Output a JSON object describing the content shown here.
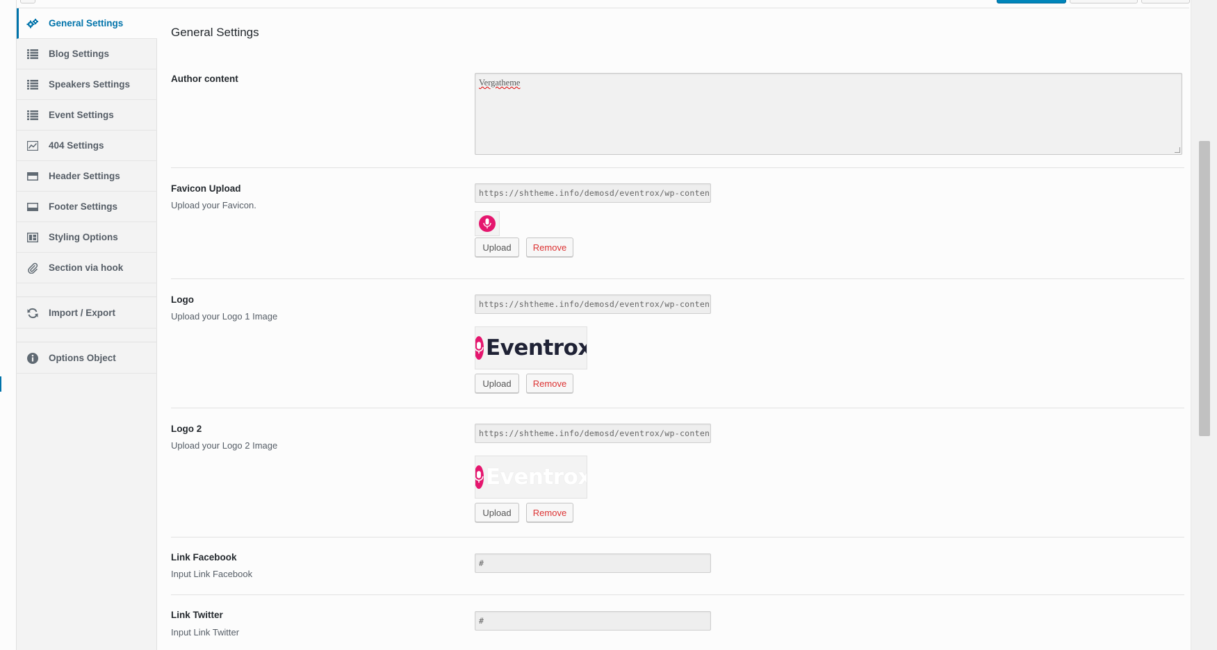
{
  "sidebar": {
    "items": [
      {
        "label": "General Settings",
        "icon": "gears-icon",
        "active": true
      },
      {
        "label": "Blog Settings",
        "icon": "list-icon"
      },
      {
        "label": "Speakers Settings",
        "icon": "list-icon"
      },
      {
        "label": "Event Settings",
        "icon": "list-icon"
      },
      {
        "label": "404 Settings",
        "icon": "chart-icon"
      },
      {
        "label": "Header Settings",
        "icon": "header-icon"
      },
      {
        "label": "Footer Settings",
        "icon": "footer-icon"
      },
      {
        "label": "Styling Options",
        "icon": "layout-icon"
      },
      {
        "label": "Section via hook",
        "icon": "paperclip-icon"
      },
      {
        "label": "Import / Export",
        "icon": "refresh-icon"
      },
      {
        "label": "Options Object",
        "icon": "info-icon"
      }
    ]
  },
  "main": {
    "title": "General Settings",
    "author": {
      "title": "Author content",
      "value": "Vergatheme"
    },
    "favicon": {
      "title": "Favicon Upload",
      "desc": "Upload your Favicon.",
      "url": "https://shtheme.info/demosd/eventrox/wp-content/up",
      "upload_label": "Upload",
      "remove_label": "Remove"
    },
    "logo": {
      "title": "Logo",
      "desc": "Upload your Logo 1 Image",
      "url": "https://shtheme.info/demosd/eventrox/wp-content/up",
      "logo_text": "Eventrox",
      "upload_label": "Upload",
      "remove_label": "Remove"
    },
    "logo2": {
      "title": "Logo 2",
      "desc": "Upload your Logo 2 Image",
      "url": "https://shtheme.info/demosd/eventrox/wp-content/up",
      "logo_text": "Eventrox",
      "upload_label": "Upload",
      "remove_label": "Remove"
    },
    "facebook": {
      "title": "Link Facebook",
      "desc": "Input Link Facebook",
      "value": "#"
    },
    "twitter": {
      "title": "Link Twitter",
      "desc": "Input Link Twitter",
      "value": "#"
    }
  },
  "colors": {
    "accent": "#0073aa",
    "brand_pink": "#e5166e",
    "remove_red": "#dc3232"
  }
}
